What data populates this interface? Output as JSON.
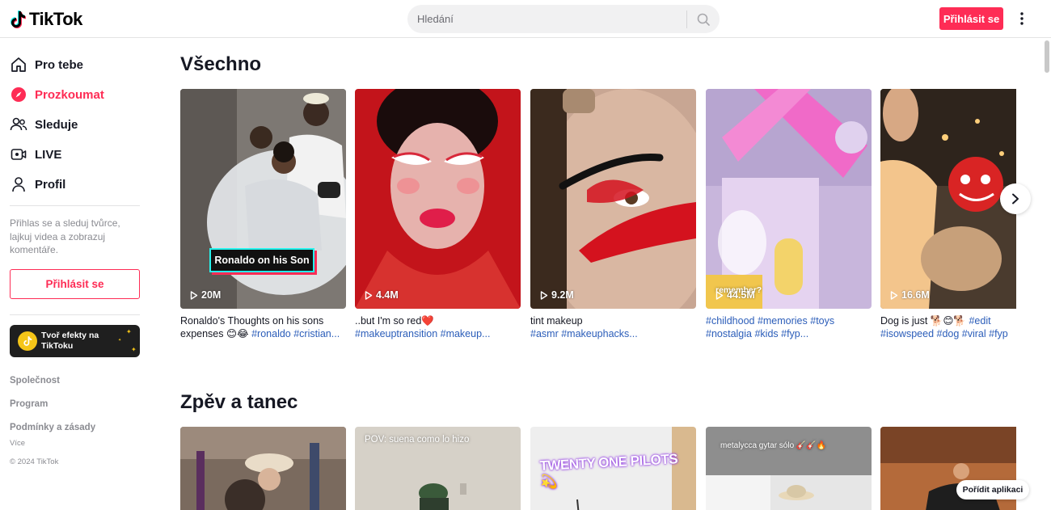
{
  "header": {
    "logo_text": "TikTok",
    "search_placeholder": "Hledání",
    "login_label": "Přihlásit se"
  },
  "sidebar": {
    "items": [
      {
        "label": "Pro tebe",
        "icon": "home-icon",
        "active": false
      },
      {
        "label": "Prozkoumat",
        "icon": "compass-icon",
        "active": true
      },
      {
        "label": "Sleduje",
        "icon": "users-icon",
        "active": false
      },
      {
        "label": "LIVE",
        "icon": "live-icon",
        "active": false
      },
      {
        "label": "Profil",
        "icon": "profile-icon",
        "active": false
      }
    ],
    "login_hint": "Přihlas se a sleduj tvůrce, lajkuj videa a zobrazuj komentáře.",
    "login_label": "Přihlásit se",
    "effects_label": "Tvoř efekty na TikToku",
    "footer": {
      "company": "Společnost",
      "program": "Program",
      "terms": "Podmínky a zásady",
      "more": "Více",
      "copyright": "© 2024 TikTok"
    }
  },
  "main": {
    "section1_title": "Všechno",
    "section2_title": "Zpěv a tanec",
    "videos": [
      {
        "views": "20M",
        "overlay": "Ronaldo on his Son",
        "caption_line1": "Ronaldo's Thoughts on his sons",
        "caption_line2_text": "expenses 😊😂 ",
        "caption_line2_tags": "#ronaldo #cristian..."
      },
      {
        "views": "4.4M",
        "caption_line1": "..but I'm so red❤️",
        "caption_line2_tags": "#makeuptransition #makeup..."
      },
      {
        "views": "9.2M",
        "caption_line1": "tint makeup",
        "caption_line2_tags": "#asmr #makeuphacks..."
      },
      {
        "views": "44.5M",
        "overlay": "remember?",
        "caption_line1_tags": "#childhood #memories #toys",
        "caption_line2_tags": "#nostalgia #kids #fyp..."
      },
      {
        "views": "16.6M",
        "caption_line1_text": "Dog is just 🐕😊🐕 ",
        "caption_line1_tags": "#edit",
        "caption_line2_tags": "#isowspeed #dog #viral #fyp"
      }
    ],
    "row2_clips": [
      {
        "overlay": ""
      },
      {
        "overlay": "POV: suena como lo hizo"
      },
      {
        "overlay": "TWENTY ONE PILOTS 💫"
      },
      {
        "overlay": "metalycca gytar sólo 🎸🎸🔥"
      },
      {
        "overlay": ""
      }
    ],
    "get_app_label": "Pořídit aplikaci"
  },
  "colors": {
    "brand": "#fe2c55",
    "tag": "#2b5db9",
    "text": "#161823",
    "muted": "#8a8b91"
  }
}
